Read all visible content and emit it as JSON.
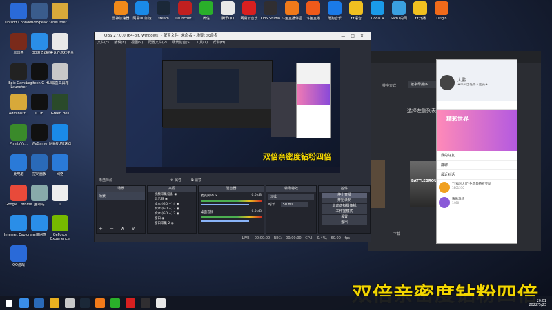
{
  "desktop_icons_left": [
    {
      "label": "Ubisoft Connect",
      "icon": "ubisoft-icon",
      "color": "#2a6ad8"
    },
    {
      "label": "TeamSpeak 3",
      "icon": "teamspeak-icon",
      "color": "#3a5c8c"
    },
    {
      "label": "TheOther...",
      "icon": "folder-icon",
      "color": "#d8a93a"
    },
    {
      "label": "三国杀",
      "icon": "sanguosha-icon",
      "color": "#7a2a1a"
    },
    {
      "label": "QQ浏览器",
      "icon": "qq-browser-icon",
      "color": "#2a8ee8"
    },
    {
      "label": "完美世界游戏平台",
      "icon": "wanmei-icon",
      "color": "#e8e8e8"
    },
    {
      "label": "Epic Games Launcher",
      "icon": "epic-icon",
      "color": "#222"
    },
    {
      "label": "Logitech G HUB",
      "icon": "logitech-icon",
      "color": "#111"
    },
    {
      "label": "黑盒工具箱",
      "icon": "heihe-icon",
      "color": "#c8c8c8"
    },
    {
      "label": "Administr...",
      "icon": "user-folder-icon",
      "color": "#d8a93a"
    },
    {
      "label": "iCUE",
      "icon": "icue-icon",
      "color": "#111"
    },
    {
      "label": "Green Hell",
      "icon": "greenhell-icon",
      "color": "#2a4a2a"
    },
    {
      "label": "PlantsVs...",
      "icon": "pvz-icon",
      "color": "#3a8a2a"
    },
    {
      "label": "WeGame",
      "icon": "wegame-icon",
      "color": "#111"
    },
    {
      "label": "网易UU加速器",
      "icon": "uu-icon",
      "color": "#1a8ae8"
    },
    {
      "label": "此电脑",
      "icon": "this-pc-icon",
      "color": "#2a7ad8"
    },
    {
      "label": "控制面板",
      "icon": "control-panel-icon",
      "color": "#2a6ab8"
    },
    {
      "label": "网络",
      "icon": "network-icon",
      "color": "#2a7ad8"
    },
    {
      "label": "Google Chrome",
      "icon": "chrome-icon",
      "color": "#e84a3a"
    },
    {
      "label": "回收站",
      "icon": "recycle-bin-icon",
      "color": "#8aa"
    },
    {
      "label": "1",
      "icon": "file-icon",
      "color": "#eee"
    },
    {
      "label": "Internet Explorer",
      "icon": "ie-icon",
      "color": "#2a8ee8"
    },
    {
      "label": "百度网盘",
      "icon": "baidu-pan-icon",
      "color": "#2a8ee8"
    },
    {
      "label": "GeForce Experience",
      "icon": "geforce-icon",
      "color": "#76b900"
    },
    {
      "label": "QQ游戏",
      "icon": "qq-game-icon",
      "color": "#2a6ad8"
    }
  ],
  "desktop_icons_top": [
    {
      "label": "雷神加速器",
      "icon": "leishen-icon",
      "color": "#f08a1a"
    },
    {
      "label": "网易UU加速",
      "icon": "uu-icon",
      "color": "#1a8ae8"
    },
    {
      "label": "steam",
      "icon": "steam-icon",
      "color": "#1b2838"
    },
    {
      "label": "Launcher...",
      "icon": "launcher-icon",
      "color": "#c02020"
    },
    {
      "label": "微信",
      "icon": "wechat-icon",
      "color": "#2ab02a"
    },
    {
      "label": "腾讯QQ",
      "icon": "qq-icon",
      "color": "#e8e8e8"
    },
    {
      "label": "网易云音乐",
      "icon": "netease-music-icon",
      "color": "#d82020"
    },
    {
      "label": "OBS Studio",
      "icon": "obs-icon",
      "color": "#302e31"
    },
    {
      "label": "斗鱼直播伴侣",
      "icon": "douyu-icon",
      "color": "#f07a1a"
    },
    {
      "label": "斗鱼直播",
      "icon": "douyu-live-icon",
      "color": "#f05a1a"
    },
    {
      "label": "酷狗音乐",
      "icon": "kugou-icon",
      "color": "#1a7ae8"
    },
    {
      "label": "YY语音",
      "icon": "yy-icon",
      "color": "#f0c020"
    },
    {
      "label": "iTools 4",
      "icon": "itools-icon",
      "color": "#1a9ae8"
    },
    {
      "label": "Sam1的网",
      "icon": "sam-icon",
      "color": "#3aa0e0"
    },
    {
      "label": "YY开播",
      "icon": "yy-live-icon",
      "color": "#f0c020"
    },
    {
      "label": "Origin",
      "icon": "origin-icon",
      "color": "#f06a1a"
    }
  ],
  "obs": {
    "title": "OBS 27.0.0 (64-bit, windows) - 配置文件: 未命名 - 场景: 未命名",
    "menu": "文件(F)  编辑(E)  视图(V)  配置文件(P)  场景集合(S)  工具(T)  帮助(H)",
    "no_source": "未选择源",
    "props": "属性",
    "filters": "滤镜",
    "docks": [
      "场景",
      "来源",
      "混音器",
      "转场特效",
      "控件"
    ],
    "scene_item": "场景",
    "sources": [
      "视频采集设备",
      "显示器",
      "文本 (GDI+) 4",
      "文本 (GDI+) 3",
      "文本 (GDI+) 2",
      "窗口",
      "窗口采集 2"
    ],
    "mixer": [
      {
        "name": "麦克风/Aux",
        "db": "0.0 dB"
      },
      {
        "name": "桌面音频",
        "db": "0.0 dB"
      }
    ],
    "transition": {
      "type": "淡出",
      "duration_label": "时长",
      "duration": "50 ms"
    },
    "controls": [
      "停止直播",
      "开始录制",
      "启动虚拟摄像机",
      "工作室模式",
      "设置",
      "退出"
    ],
    "status": {
      "live": "LIVE: 00:00:00",
      "rec": "REC: 00:00:00",
      "cpu": "CPU: 0.4%, 60.00 fps"
    }
  },
  "bg_app": {
    "sort_label": "排序方式",
    "sort_value": "按字母排序",
    "hint": "选择左侧列表中的游戏",
    "game1": "BATTLEGROUNDS",
    "button": "下载"
  },
  "qq": {
    "name": "大鹏",
    "status": "★带头出任务人团员★",
    "banner": "精彩世界",
    "sections": [
      "我的好友",
      "群聊",
      "最近对话"
    ],
    "chats": [
      {
        "name": "YY福利大厅-免费领特权奖励",
        "sub": "1801570"
      },
      {
        "name": "快乐马场",
        "sub": "1460"
      }
    ]
  },
  "overlay_text": "双倍亲密度钻粉四倍",
  "preview_overlay_text": "双倍亲密度钻粉四倍",
  "taskbar": {
    "time": "20:01",
    "date": "2022/5/23"
  }
}
